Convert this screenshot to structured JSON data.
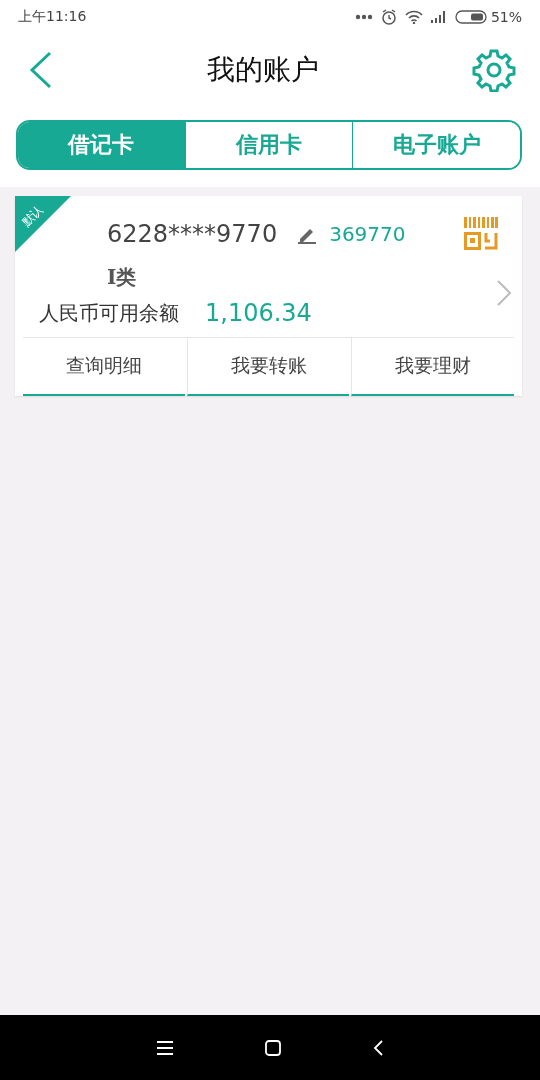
{
  "status_bar": {
    "time": "上午11:16",
    "battery": "51%"
  },
  "header": {
    "title": "我的账户"
  },
  "tabs": [
    {
      "label": "借记卡",
      "selected": true
    },
    {
      "label": "信用卡",
      "selected": false
    },
    {
      "label": "电子账户",
      "selected": false
    }
  ],
  "card": {
    "badge": "默认",
    "number": "6228****9770",
    "alias": "369770",
    "type": "Ⅰ类",
    "balance_label": "人民币可用余额",
    "balance": "1,106.34",
    "actions": [
      "查询明细",
      "我要转账",
      "我要理财"
    ]
  }
}
